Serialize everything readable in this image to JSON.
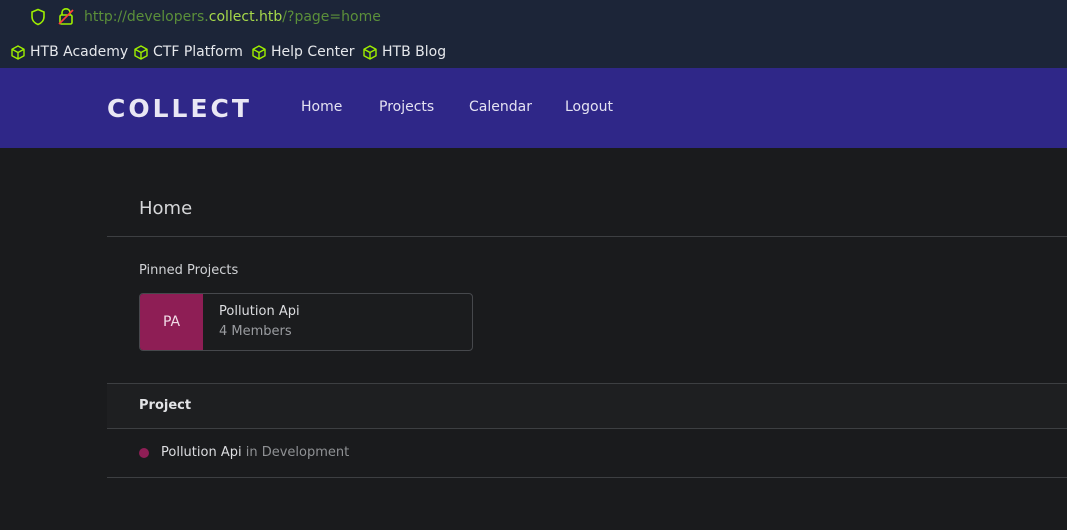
{
  "browser": {
    "url_prefix": "http://developers.",
    "url_domain": "collect.htb",
    "url_suffix": "/?page=home",
    "bookmarks": [
      {
        "label": "HTB Academy"
      },
      {
        "label": "CTF Platform"
      },
      {
        "label": "Help Center"
      },
      {
        "label": "HTB Blog"
      }
    ],
    "icon_color": "#9fef00"
  },
  "site": {
    "brand": "COLLECT",
    "nav": [
      "Home",
      "Projects",
      "Calendar",
      "Logout"
    ],
    "header_color": "#2f2788"
  },
  "main": {
    "title": "Home",
    "pinned_label": "Pinned Projects",
    "pinned": {
      "initials": "PA",
      "name": "Pollution Api",
      "members": "4 Members",
      "color": "#8e1e55"
    },
    "table": {
      "header": "Project",
      "rows": [
        {
          "name": "Pollution Api",
          "status": " in Development"
        }
      ]
    }
  }
}
